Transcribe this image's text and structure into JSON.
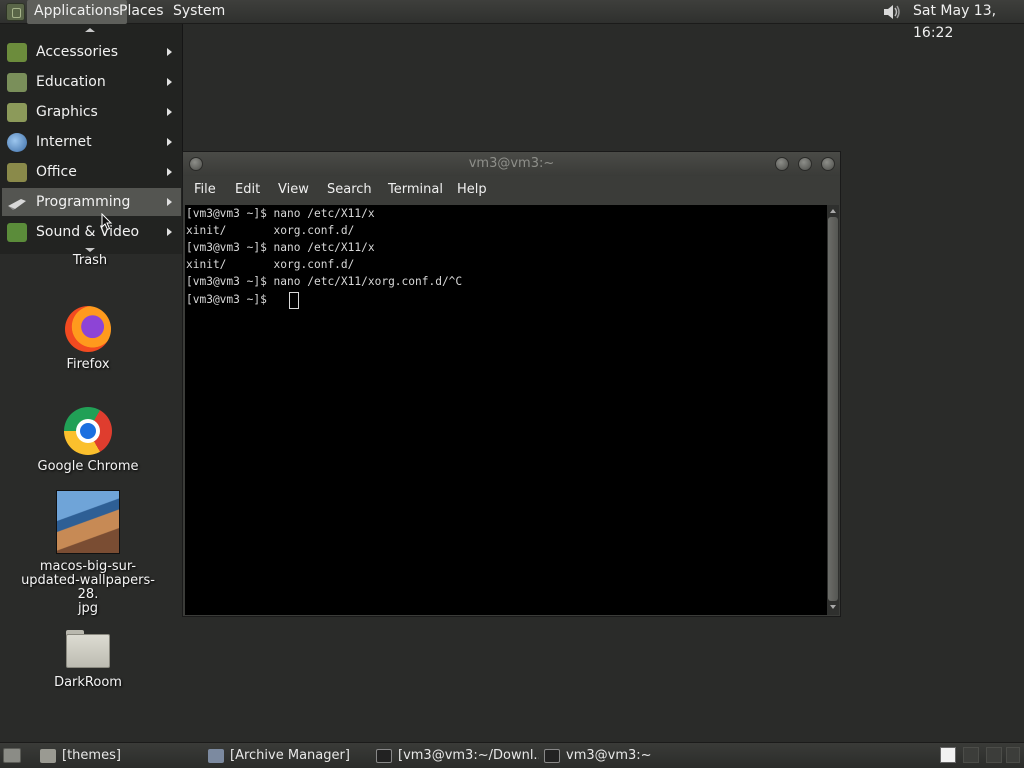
{
  "top_panel": {
    "menus": [
      "Applications",
      "Places",
      "System"
    ],
    "clock": "Sat May 13, 16:22"
  },
  "applications_menu": {
    "items": [
      {
        "label": "Accessories",
        "icon": "accessories-icon",
        "color": "#6c8c3c"
      },
      {
        "label": "Education",
        "icon": "education-icon",
        "color": "#7a8f5a"
      },
      {
        "label": "Graphics",
        "icon": "graphics-icon",
        "color": "#8c9a5a"
      },
      {
        "label": "Internet",
        "icon": "internet-icon",
        "color": "#4f7fb8"
      },
      {
        "label": "Office",
        "icon": "office-icon",
        "color": "#8a8a4a"
      },
      {
        "label": "Programming",
        "icon": "programming-icon",
        "color": "#cfcfcf",
        "highlighted": true
      },
      {
        "label": "Sound & Video",
        "icon": "sound-video-icon",
        "color": "#5b8c3a"
      }
    ]
  },
  "desktop": {
    "icons": [
      {
        "label": "Trash"
      },
      {
        "label": "Firefox"
      },
      {
        "label": "Google Chrome"
      },
      {
        "label_lines": [
          "macos-big-sur-",
          "updated-wallpapers-28.",
          "jpg"
        ]
      },
      {
        "label": "DarkRoom"
      }
    ]
  },
  "terminal": {
    "title": "vm3@vm3:~",
    "menu": [
      "File",
      "Edit",
      "View",
      "Search",
      "Terminal",
      "Help"
    ],
    "lines": [
      "[vm3@vm3 ~]$ nano /etc/X11/x",
      "xinit/       xorg.conf.d/",
      "[vm3@vm3 ~]$ nano /etc/X11/x",
      "xinit/       xorg.conf.d/",
      "[vm3@vm3 ~]$ nano /etc/X11/xorg.conf.d/^C",
      "[vm3@vm3 ~]$ "
    ]
  },
  "taskbar": {
    "tasks": [
      {
        "label": "[themes]",
        "icon": "folder-icon"
      },
      {
        "label": "[Archive Manager]",
        "icon": "archive-manager-icon"
      },
      {
        "label": "[vm3@vm3:~/Downl...",
        "icon": "terminal-icon"
      },
      {
        "label": "vm3@vm3:~",
        "icon": "terminal-icon"
      }
    ]
  },
  "colors": {
    "desktop_bg": "#2a2b29",
    "panel": "#353633",
    "terminal_bg": "#000000",
    "terminal_fg": "#d8d8d8",
    "menu_highlight": "#545551"
  }
}
